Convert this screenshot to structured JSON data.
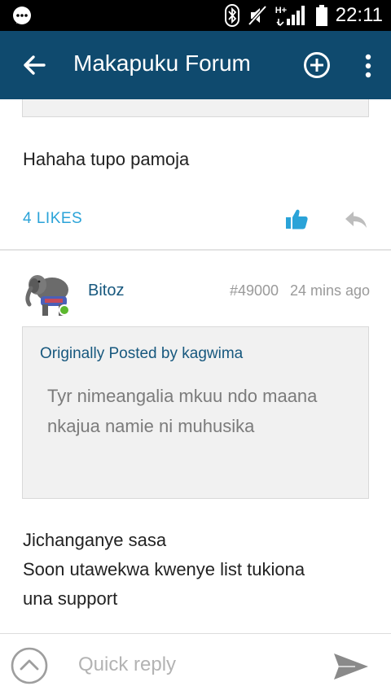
{
  "status_bar": {
    "time": "22:11",
    "network_label": "H+",
    "icons": [
      "messenger-icon",
      "bluetooth-icon",
      "mute-icon",
      "signal-icon",
      "battery-icon"
    ]
  },
  "app_bar": {
    "title": "Makapuku Forum",
    "background": "#0f4a6e"
  },
  "previous_post": {
    "text": "Hahaha tupo pamoja",
    "likes_label": "4 LIKES"
  },
  "post": {
    "author": "Bitoz",
    "number": "#49000",
    "time": "24 mins ago",
    "online": true,
    "quote": {
      "header": "Originally Posted by kagwima",
      "text": "Tyr nimeangalia mkuu ndo maana nkajua namie ni muhusika"
    },
    "body_lines": [
      "Jichanganye sasa",
      "Soon utawekwa kwenye list tukiona",
      "una support"
    ]
  },
  "reply_bar": {
    "placeholder": "Quick reply"
  },
  "colors": {
    "accent": "#2aa3d8",
    "link": "#17587e",
    "online": "#5cb82e"
  }
}
